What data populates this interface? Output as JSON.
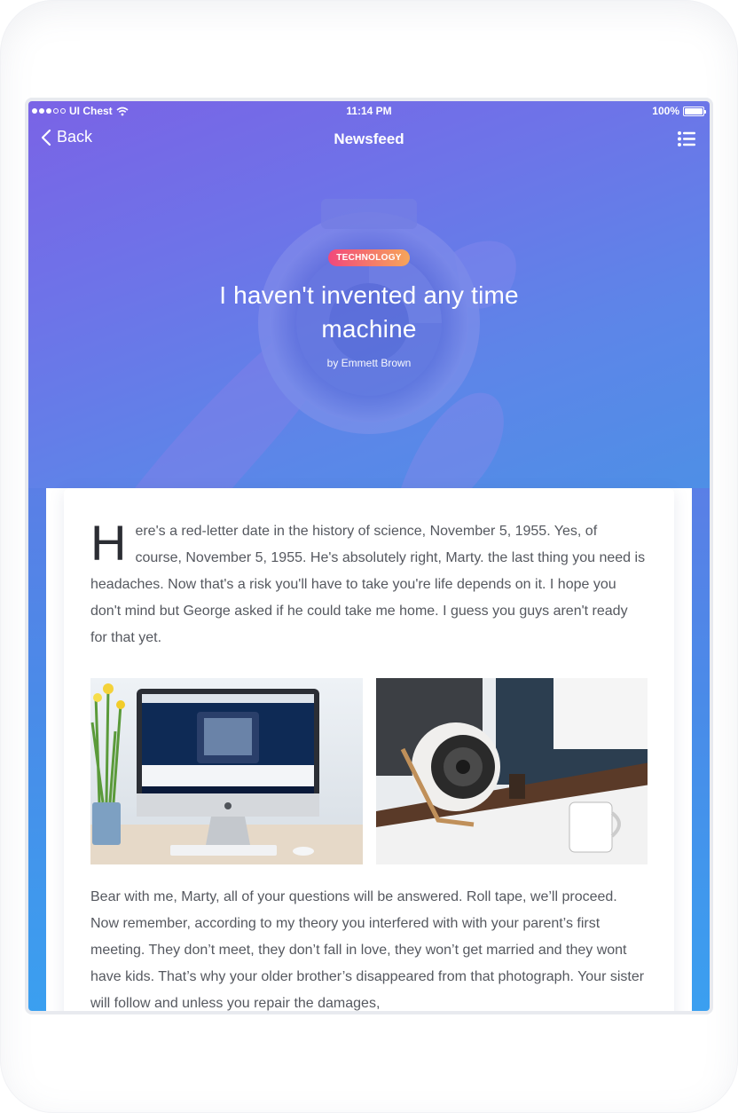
{
  "status_bar": {
    "carrier": "UI Chest",
    "time": "11:14 PM",
    "battery": "100%",
    "battery_level": 1.0
  },
  "nav": {
    "back_label": "Back",
    "title": "Newsfeed"
  },
  "hero": {
    "tag": "TECHNOLOGY",
    "title": "I haven't invented any time machine",
    "byline": "by Emmett Brown"
  },
  "article": {
    "drop_cap": "H",
    "paragraph_1": "ere's a red-letter date in the history of science, November 5, 1955. Yes, of course, November 5, 1955. He's absolutely right, Marty. the last thing you need is headaches. Now that's a risk you'll have to take you're life depends on it. I hope you don't mind but George asked if he could take me home. I guess you guys aren't ready for that yet.",
    "paragraph_2": "Bear with me, Marty, all of your questions will be answered. Roll tape, we’ll proceed. Now remember, according to my theory you interfered with with your parent’s first meeting. They don’t meet, they don’t fall in love, they won’t get married and they wont have kids. That’s why your older brother’s disappeared from that photograph. Your sister will follow and unless you repair the damages,"
  },
  "images": [
    {
      "name": "imac-on-desk-photo"
    },
    {
      "name": "speaker-on-desk-photo"
    }
  ],
  "icons": {
    "back": "chevron-left-icon",
    "menu": "list-icon",
    "wifi": "wifi-icon",
    "battery": "battery-icon"
  },
  "colors": {
    "hero_gradient_start": "#7a63e6",
    "hero_gradient_end": "#4e8fe6",
    "tag_gradient_start": "#f2487c",
    "tag_gradient_end": "#f6a65a",
    "body_text": "#55585f"
  }
}
